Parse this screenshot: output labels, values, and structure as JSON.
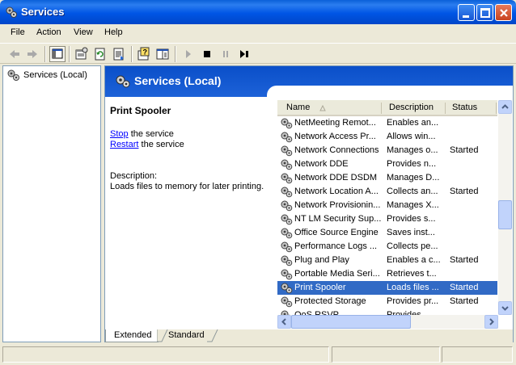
{
  "window": {
    "title": "Services"
  },
  "menu": {
    "items": [
      "File",
      "Action",
      "View",
      "Help"
    ]
  },
  "tree": {
    "root_label": "Services (Local)"
  },
  "header": {
    "title": "Services (Local)"
  },
  "selected_service": {
    "name": "Print Spooler",
    "stop_link": "Stop",
    "stop_suffix": " the service",
    "restart_link": "Restart",
    "restart_suffix": " the service",
    "description_label": "Description:",
    "description_text": "Loads files to memory for later printing."
  },
  "list": {
    "columns": [
      "Name",
      "Description",
      "Status"
    ],
    "rows": [
      {
        "name": "NetMeeting Remot...",
        "description": "Enables an...",
        "status": ""
      },
      {
        "name": "Network Access Pr...",
        "description": "Allows win...",
        "status": ""
      },
      {
        "name": "Network Connections",
        "description": "Manages o...",
        "status": "Started"
      },
      {
        "name": "Network DDE",
        "description": "Provides n...",
        "status": ""
      },
      {
        "name": "Network DDE DSDM",
        "description": "Manages D...",
        "status": ""
      },
      {
        "name": "Network Location A...",
        "description": "Collects an...",
        "status": "Started"
      },
      {
        "name": "Network Provisionin...",
        "description": "Manages X...",
        "status": ""
      },
      {
        "name": "NT LM Security Sup...",
        "description": "Provides s...",
        "status": ""
      },
      {
        "name": "Office Source Engine",
        "description": "Saves inst...",
        "status": ""
      },
      {
        "name": "Performance Logs ...",
        "description": "Collects pe...",
        "status": ""
      },
      {
        "name": "Plug and Play",
        "description": "Enables a c...",
        "status": "Started"
      },
      {
        "name": "Portable Media Seri...",
        "description": "Retrieves t...",
        "status": ""
      },
      {
        "name": "Print Spooler",
        "description": "Loads files ...",
        "status": "Started",
        "selected": true
      },
      {
        "name": "Protected Storage",
        "description": "Provides pr...",
        "status": "Started"
      },
      {
        "name": "QoS RSVP",
        "description": "Provides...",
        "status": ""
      }
    ]
  },
  "tabs": [
    "Extended",
    "Standard"
  ],
  "colors": {
    "titlebar": "#0055e5",
    "selection": "#316ac5",
    "link": "#0000ff"
  }
}
